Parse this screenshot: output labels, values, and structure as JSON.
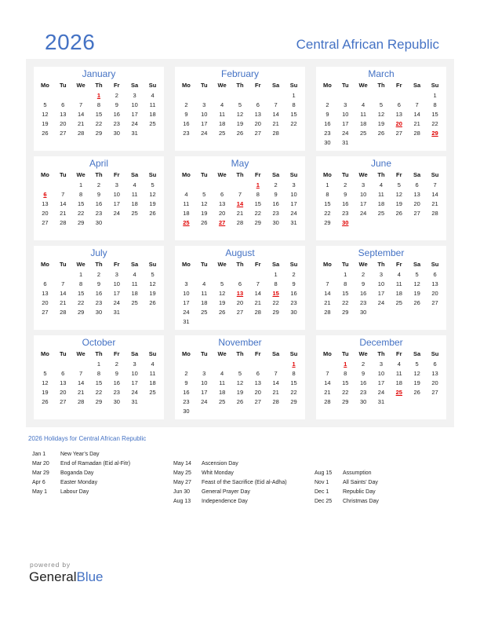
{
  "header": {
    "year": "2026",
    "country": "Central African Republic"
  },
  "weekdays": [
    "Mo",
    "Tu",
    "We",
    "Th",
    "Fr",
    "Sa",
    "Su"
  ],
  "months": [
    {
      "name": "January",
      "offset": 3,
      "days": 31,
      "holidays": [
        1
      ]
    },
    {
      "name": "February",
      "offset": 6,
      "days": 28,
      "holidays": []
    },
    {
      "name": "March",
      "offset": 6,
      "days": 31,
      "holidays": [
        20,
        29
      ]
    },
    {
      "name": "April",
      "offset": 2,
      "days": 30,
      "holidays": [
        6
      ]
    },
    {
      "name": "May",
      "offset": 4,
      "days": 31,
      "holidays": [
        1,
        14,
        25,
        27
      ]
    },
    {
      "name": "June",
      "offset": 0,
      "days": 30,
      "holidays": [
        30
      ]
    },
    {
      "name": "July",
      "offset": 2,
      "days": 31,
      "holidays": []
    },
    {
      "name": "August",
      "offset": 5,
      "days": 31,
      "holidays": [
        13,
        15
      ]
    },
    {
      "name": "September",
      "offset": 1,
      "days": 30,
      "holidays": []
    },
    {
      "name": "October",
      "offset": 3,
      "days": 31,
      "holidays": []
    },
    {
      "name": "November",
      "offset": 6,
      "days": 30,
      "holidays": [
        1
      ]
    },
    {
      "name": "December",
      "offset": 1,
      "days": 31,
      "holidays": [
        1,
        25
      ]
    }
  ],
  "holidays_title": "2026 Holidays for Central African Republic",
  "holiday_columns": [
    [
      {
        "date": "Jan 1",
        "name": "New Year’s Day"
      },
      {
        "date": "Mar 20",
        "name": "End of Ramadan (Eid al-Fitr)"
      },
      {
        "date": "Mar 29",
        "name": "Boganda Day"
      },
      {
        "date": "Apr 6",
        "name": "Easter Monday"
      },
      {
        "date": "May 1",
        "name": "Labour Day"
      }
    ],
    [
      {
        "date": "May 14",
        "name": "Ascension Day"
      },
      {
        "date": "May 25",
        "name": "Whit Monday"
      },
      {
        "date": "May 27",
        "name": "Feast of the Sacrifice (Eid al-Adha)"
      },
      {
        "date": "Jun 30",
        "name": "General Prayer Day"
      },
      {
        "date": "Aug 13",
        "name": "Independence Day"
      }
    ],
    [
      {
        "date": "Aug 15",
        "name": "Assumption"
      },
      {
        "date": "Nov 1",
        "name": "All Saints’ Day"
      },
      {
        "date": "Dec 1",
        "name": "Republic Day"
      },
      {
        "date": "Dec 25",
        "name": "Christmas Day"
      }
    ]
  ],
  "footer": {
    "powered_by": "powered by",
    "brand_part1": "General",
    "brand_part2": "Blue"
  },
  "colors": {
    "accent": "#4472c4",
    "holiday": "#e00000",
    "panel_bg": "#f2f2f2"
  }
}
